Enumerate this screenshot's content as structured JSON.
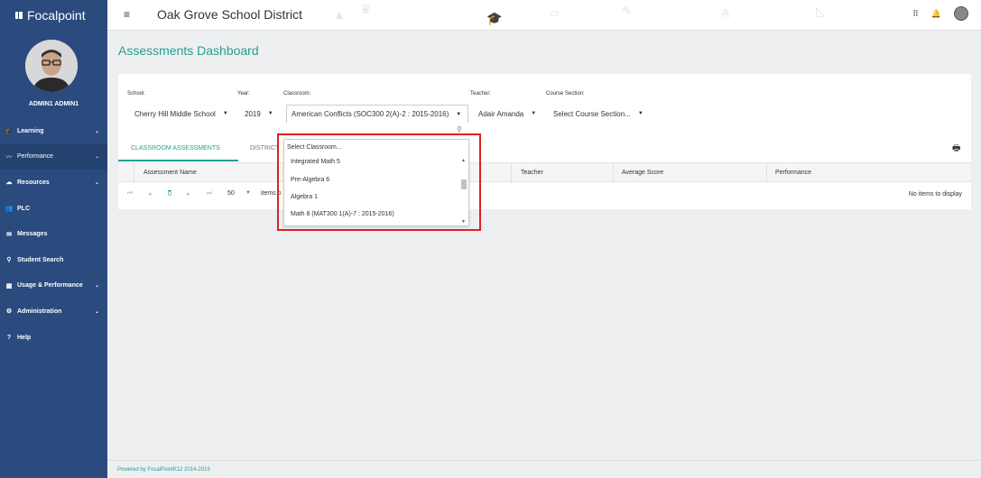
{
  "app": {
    "brand": "Focalpoint",
    "district": "Oak Grove School District"
  },
  "user": {
    "name": "ADMIN1 ADMIN1"
  },
  "sidebar": {
    "items": [
      {
        "label": "Learning",
        "icon": "graduation-cap-icon",
        "chevron": "⌄"
      },
      {
        "label": "Performance",
        "icon": "trend-line-icon",
        "chevron": "⌄"
      },
      {
        "label": "Resources",
        "icon": "cloud-icon",
        "chevron": "⌄"
      },
      {
        "label": "PLC",
        "icon": "users-icon"
      },
      {
        "label": "Messages",
        "icon": "envelope-icon"
      },
      {
        "label": "Student Search",
        "icon": "search-icon"
      },
      {
        "label": "Usage & Performance",
        "icon": "dashboard-icon",
        "chevron": "⌄"
      },
      {
        "label": "Administration",
        "icon": "gear-icon",
        "chevron": "⌄"
      },
      {
        "label": "Help",
        "icon": "question-icon"
      }
    ]
  },
  "page": {
    "title": "Assessments Dashboard"
  },
  "filters": {
    "school": {
      "label": "School:",
      "value": "Cherry Hill Middle School"
    },
    "year": {
      "label": "Year:",
      "value": "2019"
    },
    "classroom": {
      "label": "Classroom:",
      "value": "American Conflicts (SOC300 2(A)-2 : 2015-2016)"
    },
    "teacher": {
      "label": "Teacher:",
      "value": "Adair Amanda"
    },
    "course_section": {
      "label": "Course Section:",
      "value": "Select Course Section..."
    }
  },
  "tabs": [
    {
      "label": "CLASSROOM ASSESSMENTS"
    },
    {
      "label": "DISTRICT"
    }
  ],
  "table": {
    "columns": [
      "Assessment Name",
      "Teacher",
      "Average Score",
      "Performance"
    ],
    "empty_text": "No items to display"
  },
  "pager": {
    "first": "⏮",
    "prev": "◂",
    "current": "0",
    "next": "▸",
    "last": "⏭",
    "page_size": "50",
    "items_label": "items p"
  },
  "classroom_dropdown": {
    "placeholder": "Select Classroom...",
    "options": [
      "Integrated Math 5",
      "Pre-Algebra 6",
      "Algebra 1",
      "Math 8 (MAT300 1(A)-7 : 2015-2016)"
    ]
  },
  "footer": {
    "text": "Powered by FocalPointK12 2014-2019"
  },
  "colors": {
    "sidebar": "#2b4a7e",
    "accent": "#23a08f",
    "highlight": "#e02020"
  }
}
